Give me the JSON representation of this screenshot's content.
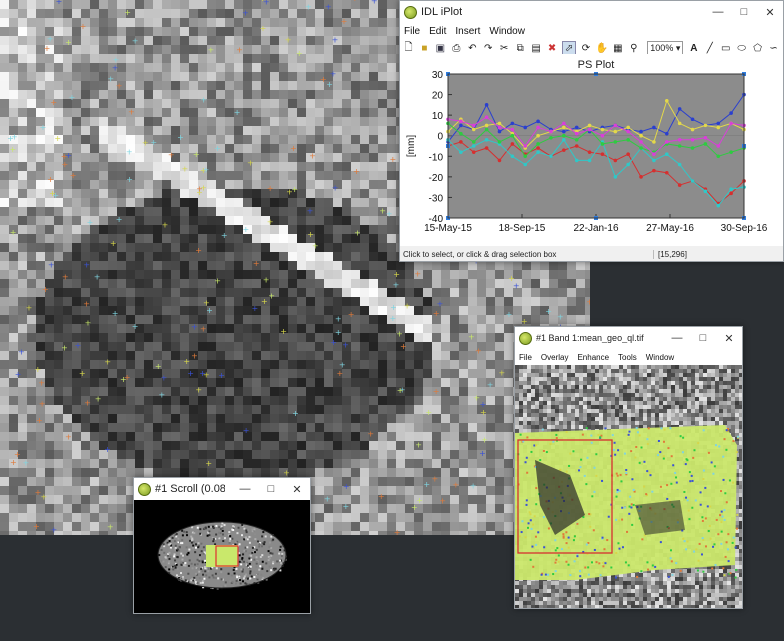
{
  "iplot": {
    "title": "IDL iPlot",
    "menus": [
      "File",
      "Edit",
      "Insert",
      "Window"
    ],
    "zoom": "100%",
    "status_hint": "Click to select, or click & drag selection box",
    "status_coords": "[15,296]"
  },
  "chart_data": {
    "type": "line",
    "title": "PS Plot",
    "ylabel": "[mm]",
    "xlabel": "",
    "ylim": [
      -40,
      30
    ],
    "y_ticks": [
      30,
      20,
      10,
      0,
      -10,
      -20,
      -30,
      -40
    ],
    "x_tick_labels": [
      "15-May-15",
      "18-Sep-15",
      "22-Jan-16",
      "27-May-16",
      "30-Sep-16"
    ],
    "x": [
      0,
      1,
      2,
      3,
      4,
      5,
      6,
      7,
      8,
      9,
      10,
      11,
      12,
      13,
      14,
      15,
      16,
      17,
      18,
      19,
      20,
      21,
      22,
      23
    ],
    "background": "#8c8c8c",
    "series": [
      {
        "color": "#2a3fcf",
        "values": [
          -3,
          5,
          3,
          15,
          2,
          6,
          4,
          7,
          3,
          2,
          4,
          2,
          4,
          5,
          3,
          2,
          4,
          1,
          13,
          8,
          5,
          6,
          11,
          20
        ]
      },
      {
        "color": "#e3d84a",
        "values": [
          2,
          8,
          3,
          5,
          6,
          1,
          -6,
          0,
          2,
          4,
          2,
          5,
          3,
          2,
          4,
          0,
          -3,
          17,
          6,
          3,
          5,
          4,
          6,
          3
        ]
      },
      {
        "color": "#d62f2f",
        "values": [
          -5,
          -3,
          -8,
          -6,
          -12,
          -4,
          -9,
          -6,
          -10,
          -7,
          -5,
          -8,
          -9,
          -12,
          -9,
          -20,
          -17,
          -18,
          -24,
          -22,
          -26,
          -33,
          -28,
          -22
        ]
      },
      {
        "color": "#2fc8c8",
        "values": [
          -2,
          -8,
          -5,
          -2,
          -4,
          -10,
          -14,
          -8,
          -10,
          -2,
          -12,
          -12,
          -3,
          -20,
          -14,
          -6,
          -12,
          -9,
          -14,
          -22,
          -27,
          -34,
          -26,
          -25
        ]
      },
      {
        "color": "#2ecc40",
        "values": [
          6,
          1,
          -3,
          3,
          -3,
          0,
          -10,
          -4,
          -1,
          0,
          -2,
          3,
          -4,
          -3,
          -2,
          -6,
          -8,
          -4,
          -5,
          -6,
          -4,
          -10,
          -8,
          -6
        ]
      },
      {
        "color": "#d93fd9",
        "values": [
          8,
          7,
          5,
          9,
          4,
          3,
          -5,
          4,
          2,
          6,
          1,
          3,
          0,
          5,
          2,
          -3,
          -9,
          -3,
          -2,
          -2,
          -1,
          -5,
          6,
          5
        ]
      }
    ]
  },
  "scroll": {
    "title": "#1 Scroll (0.085..."
  },
  "band": {
    "title": "#1 Band 1:mean_geo_ql.tif",
    "menus": [
      "File",
      "Overlay",
      "Enhance",
      "Tools",
      "Window"
    ]
  }
}
